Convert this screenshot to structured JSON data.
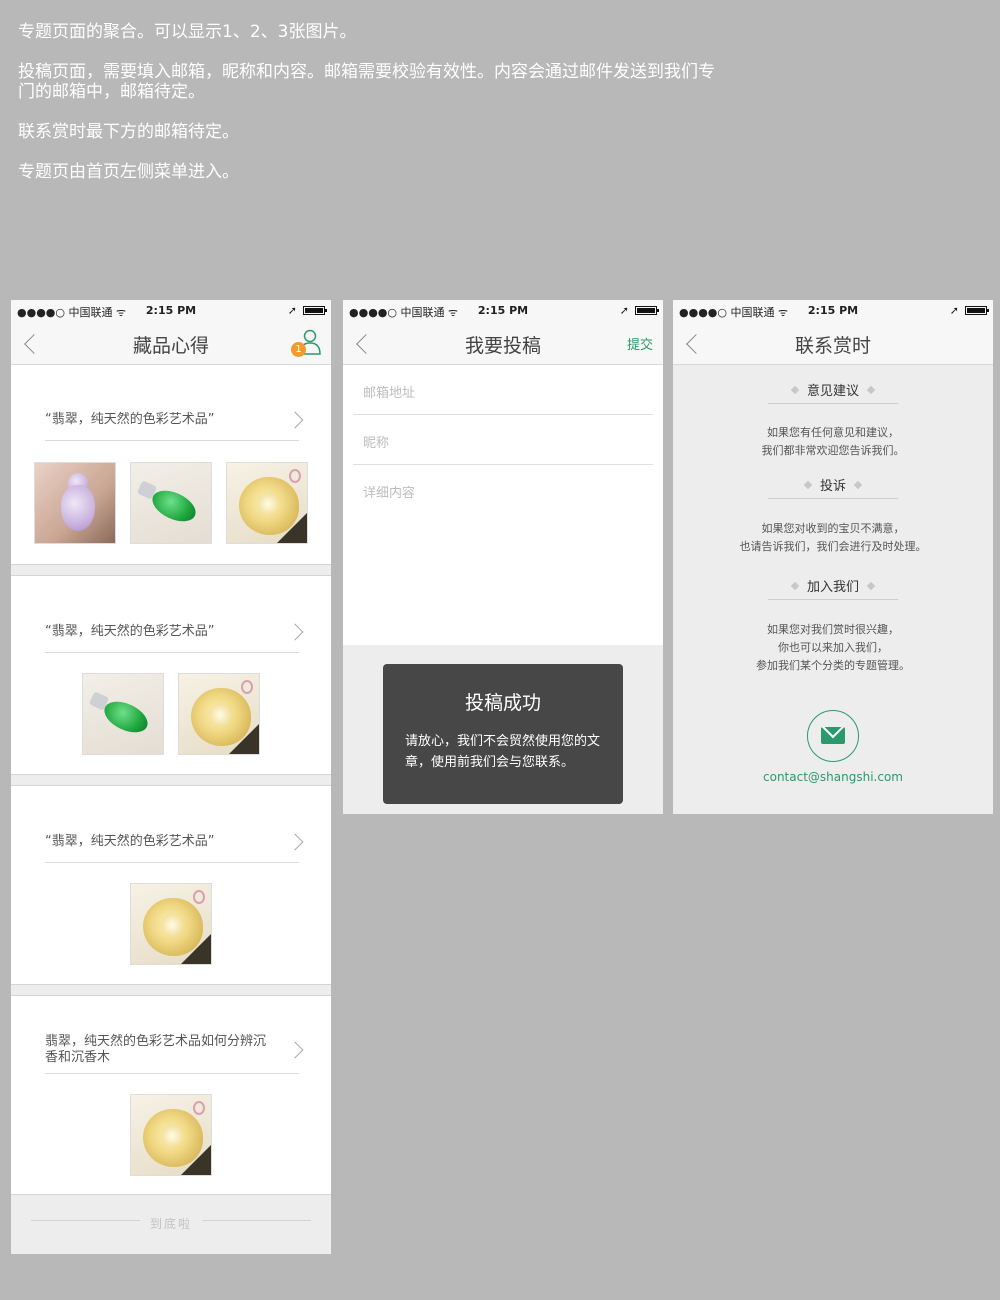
{
  "notes": [
    "专题页面的聚合。可以显示1、2、3张图片。",
    "投稿页面，需要填入邮箱，昵称和内容。邮箱需要校验有效性。内容会通过邮件发送到我们专门的邮箱中，邮箱待定。",
    "联系赏时最下方的邮箱待定。",
    "专题页由首页左侧菜单进入。"
  ],
  "status_bar": {
    "signal": "●●●●○",
    "carrier": "中国联通",
    "wifi": "ᯤ",
    "time": "2:15 PM",
    "location": "➚"
  },
  "screen1": {
    "title": "藏品心得",
    "badge": "1",
    "cards": [
      {
        "title": "“翡翠，纯天然的色彩艺术品”",
        "images": [
          "hand-lavender-jade",
          "green-jade-pendant",
          "amber-jade-pendant"
        ]
      },
      {
        "title": "“翡翠，纯天然的色彩艺术品”",
        "images": [
          "green-jade-pendant",
          "amber-jade-pendant"
        ]
      },
      {
        "title": "“翡翠，纯天然的色彩艺术品”",
        "images": [
          "amber-jade-pendant"
        ]
      },
      {
        "title": "翡翠，纯天然的色彩艺术品如何分辨沉香和沉香木",
        "images": [
          "amber-jade-pendant"
        ]
      }
    ],
    "end_text": "到底啦"
  },
  "screen2": {
    "title": "我要投稿",
    "submit": "提交",
    "email_placeholder": "邮箱地址",
    "nickname_placeholder": "昵称",
    "content_placeholder": "详细内容",
    "toast": {
      "title": "投稿成功",
      "message": "请放心，我们不会贸然使用您的文章，使用前我们会与您联系。"
    }
  },
  "screen3": {
    "title": "联系赏时",
    "sections": [
      {
        "title": "意见建议",
        "lines": [
          "如果您有任何意见和建议，",
          "我们都非常欢迎您告诉我们。"
        ]
      },
      {
        "title": "投诉",
        "lines": [
          "如果您对收到的宝贝不满意，",
          "也请告诉我们，我们会进行及时处理。"
        ]
      },
      {
        "title": "加入我们",
        "lines": [
          "如果您对我们赏时很兴趣，",
          "你也可以来加入我们，",
          "参加我们某个分类的专题管理。"
        ]
      }
    ],
    "email": "contact@shangshi.com"
  },
  "colors": {
    "accent": "#2a9a6e",
    "badge": "#f39a2b",
    "toast_bg": "#474747",
    "page_bg": "#b8b8b8"
  },
  "icons": [
    "back-chevron-icon",
    "user-icon",
    "mail-icon",
    "right-chevron-icon",
    "battery-icon",
    "wifi-icon"
  ]
}
